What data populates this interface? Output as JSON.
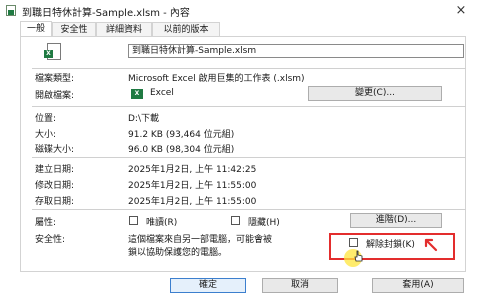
{
  "window": {
    "title": "到職日特休計算-Sample.xlsm - 內容",
    "close": "×"
  },
  "tabs": [
    {
      "label": "一般",
      "active": true
    },
    {
      "label": "安全性",
      "active": false
    },
    {
      "label": "詳細資料",
      "active": false
    },
    {
      "label": "以前的版本",
      "active": false
    }
  ],
  "file": {
    "name": "到職日特休計算-Sample.xlsm",
    "icon": "excel-file-icon"
  },
  "general": {
    "type_label": "檔案類型:",
    "type_value": "Microsoft Excel 啟用巨集的工作表 (.xlsm)",
    "opens_with_label": "開啟檔案:",
    "opens_with_value": "Excel",
    "change_button": "變更(C)...",
    "location_label": "位置:",
    "location_value": "D:\\下載",
    "size_label": "大小:",
    "size_value": "91.2 KB (93,464 位元組)",
    "size_on_disk_label": "磁碟大小:",
    "size_on_disk_value": "96.0 KB (98,304 位元組)",
    "created_label": "建立日期:",
    "created_value": "2025年1月2日, 上午 11:42:25",
    "modified_label": "修改日期:",
    "modified_value": "2025年1月2日, 上午 11:55:00",
    "accessed_label": "存取日期:",
    "accessed_value": "2025年1月2日, 上午 11:55:00",
    "attributes_label": "屬性:",
    "readonly_label": "唯讀(R)",
    "hidden_label": "隱藏(H)",
    "advanced_button": "進階(D)...",
    "security_label": "安全性:",
    "security_text_line1": "這個檔案來自另一部電腦，可能會被",
    "security_text_line2": "鎖以協助保護您的電腦。",
    "unblock_label": "解除封鎖(K)"
  },
  "footer": {
    "ok": "確定",
    "cancel": "取消",
    "apply": "套用(A)"
  },
  "colors": {
    "highlight": "#e32d2d",
    "excel_green": "#1f7a42",
    "accent": "#3c7fce"
  }
}
